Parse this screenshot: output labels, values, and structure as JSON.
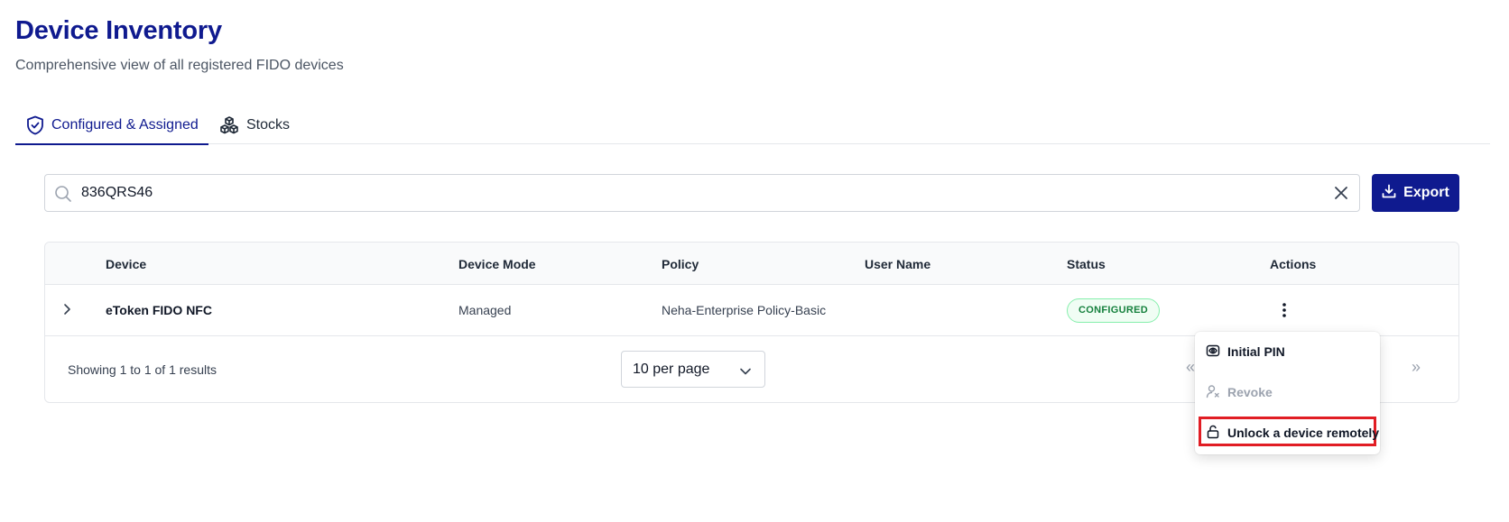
{
  "page": {
    "title": "Device Inventory",
    "subtitle": "Comprehensive view of all registered FIDO devices"
  },
  "tabs": [
    {
      "label": "Configured & Assigned",
      "icon": "shield-check-icon",
      "active": true
    },
    {
      "label": "Stocks",
      "icon": "boxes-icon",
      "active": false
    }
  ],
  "search": {
    "value": "836QRS46",
    "placeholder": ""
  },
  "toolbar": {
    "export_label": "Export"
  },
  "table": {
    "columns": [
      "Device",
      "Device Mode",
      "Policy",
      "User Name",
      "Status",
      "Actions"
    ],
    "rows": [
      {
        "device": "eToken FIDO NFC",
        "mode": "Managed",
        "policy": "Neha-Enterprise Policy-Basic",
        "user": "",
        "status": "CONFIGURED"
      }
    ]
  },
  "footer": {
    "showing": "Showing 1 to 1 of 1 results",
    "per_page": "10 per page",
    "first_label": "«",
    "last_label": "»"
  },
  "action_menu": {
    "items": [
      {
        "label": "Initial PIN",
        "icon": "eye-pin-icon",
        "enabled": true
      },
      {
        "label": "Revoke",
        "icon": "user-remove-icon",
        "enabled": false
      },
      {
        "label": "Unlock a device remotely",
        "icon": "unlock-icon",
        "enabled": true,
        "highlighted": true
      }
    ]
  },
  "colors": {
    "primary": "#0f1a8f",
    "badge_green": "#15803d",
    "highlight_red": "#e11d24"
  }
}
